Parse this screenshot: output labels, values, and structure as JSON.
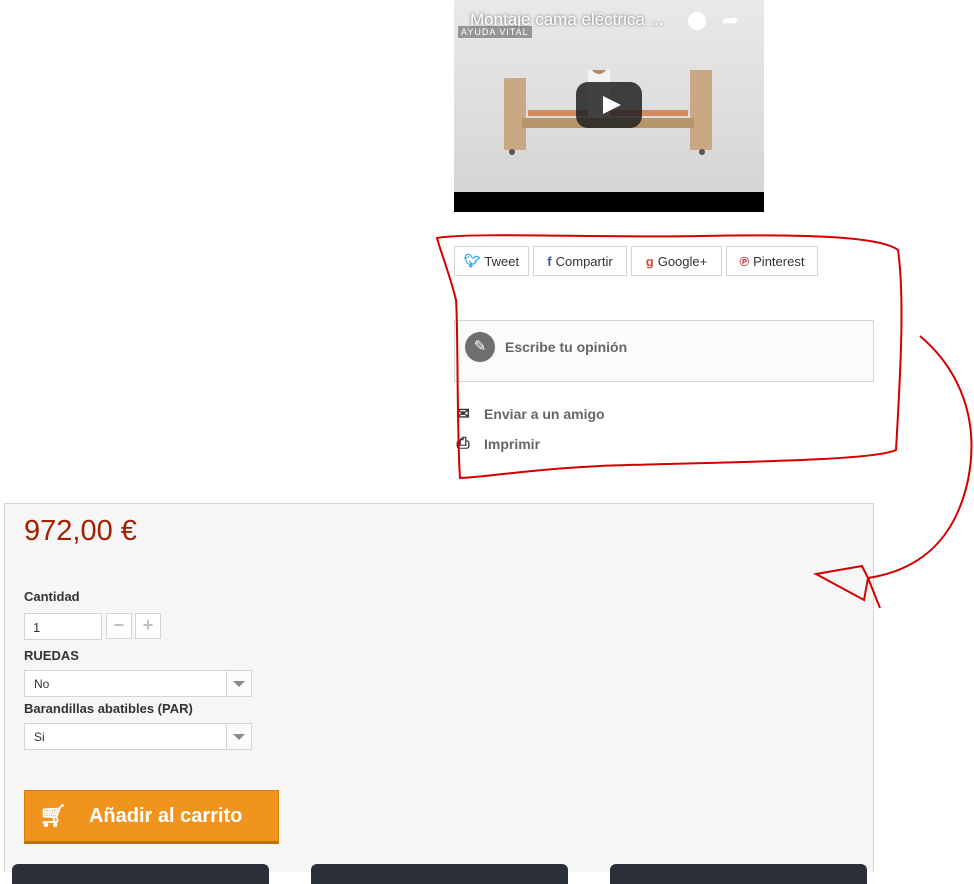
{
  "video": {
    "title": "Montaje cama eléctrica ...",
    "logo_text": "AYUDA VITAL"
  },
  "share": {
    "tweet": "Tweet",
    "compartir": "Compartir",
    "google": "Google+",
    "pinterest": "Pinterest"
  },
  "review": {
    "label": "Escribe tu opinión"
  },
  "links": {
    "send_friend": "Enviar a un amigo",
    "print": "Imprimir"
  },
  "product": {
    "price": "972,00 €",
    "quantity_label": "Cantidad",
    "quantity_value": "1",
    "ruedas_label": "RUEDAS",
    "ruedas_value": "No",
    "barandillas_label": "Barandillas abatibles (PAR)",
    "barandillas_value": "Si",
    "add_to_cart": "Añadir al carrito"
  },
  "colors": {
    "price": "#a02000",
    "cart_button": "#f0941d",
    "annotation": "#d40000"
  }
}
